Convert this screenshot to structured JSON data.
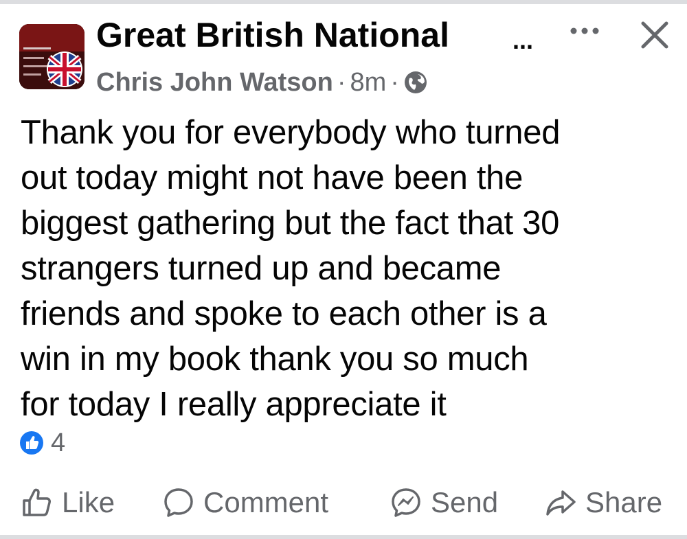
{
  "header": {
    "group_name": "Great British National",
    "group_ellipsis": "...",
    "author": "Chris John Watson",
    "time": "8m",
    "separator": "·",
    "privacy_icon": "globe-icon",
    "more_icon": "more-horizontal-icon",
    "close_icon": "close-icon"
  },
  "post": {
    "lines": [
      "Thank you for everybody who turned",
      "out today might not have been the",
      "biggest gathering but the fact that 30",
      "strangers turned up and became",
      "friends and spoke to each other is a",
      "win in my book thank you so much",
      "for today I really appreciate it"
    ]
  },
  "reactions": {
    "icon": "like-reaction-icon",
    "count": "4"
  },
  "actions": {
    "like": "Like",
    "comment": "Comment",
    "send": "Send",
    "share": "Share"
  },
  "colors": {
    "text": "#050505",
    "secondary": "#65676b",
    "like_blue": "#1877f2",
    "divider": "#dcdde0"
  }
}
